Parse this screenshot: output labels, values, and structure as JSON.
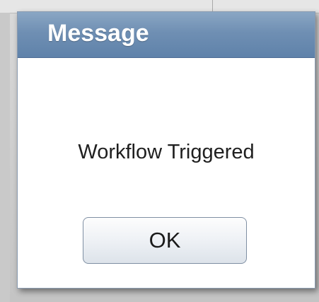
{
  "dialog": {
    "title": "Message",
    "message": "Workflow Triggered",
    "ok_label": "OK"
  },
  "colors": {
    "header": "#6f8fb3",
    "title_text": "#ffffff",
    "message_text": "#1f1f1f",
    "dialog_background": "#ffffff"
  }
}
